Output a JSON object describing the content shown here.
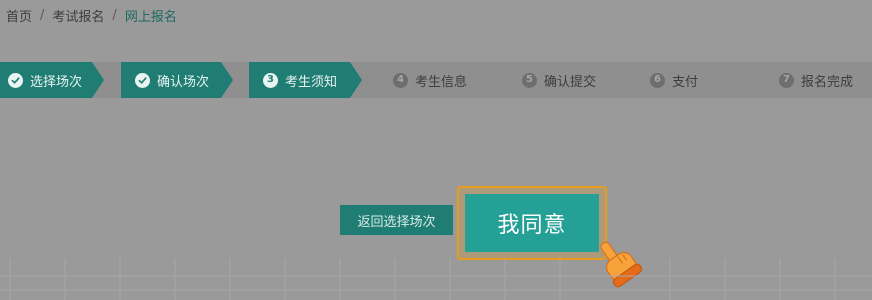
{
  "breadcrumb": {
    "items": [
      "首页",
      "考试报名",
      "网上报名"
    ],
    "separator": "/"
  },
  "steps": [
    {
      "num": "1",
      "label": "选择场次",
      "state": "done"
    },
    {
      "num": "2",
      "label": "确认场次",
      "state": "done"
    },
    {
      "num": "3",
      "label": "考生须知",
      "state": "active"
    },
    {
      "num": "4",
      "label": "考生信息",
      "state": "pending"
    },
    {
      "num": "5",
      "label": "确认提交",
      "state": "pending"
    },
    {
      "num": "6",
      "label": "支付",
      "state": "pending"
    },
    {
      "num": "7",
      "label": "报名完成",
      "state": "pending"
    }
  ],
  "actions": {
    "back_label": "返回选择场次",
    "agree_label": "我同意"
  },
  "icons": {
    "done_step": "check-circle-icon",
    "pointer": "hand-pointer-icon"
  },
  "colors": {
    "teal_dark": "#1f7d73",
    "teal_button": "#24a096",
    "highlight": "#e89c1e",
    "overlay_bg": "#9a9a9a"
  }
}
